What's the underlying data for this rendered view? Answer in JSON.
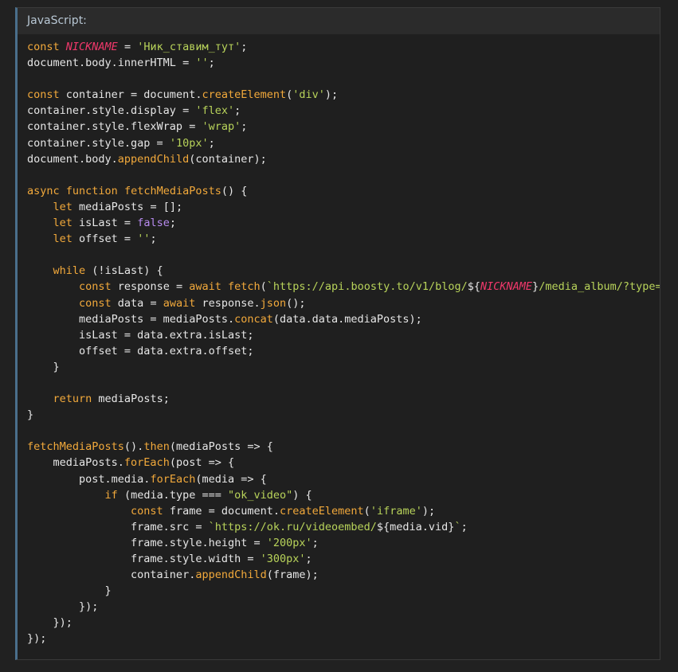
{
  "header": {
    "language_label": "JavaScript:"
  },
  "colors": {
    "background": "#212121",
    "code_background": "#1f1f1f",
    "header_background": "#2b2b2b",
    "accent_border": "#4a6f8c",
    "keyword": "#f2a93b",
    "string": "#b8d35a",
    "constant": "#f0386b",
    "boolean": "#b88bf0",
    "plain": "#e6e6e6"
  },
  "code_lines": [
    [
      [
        "keyword",
        "const"
      ],
      [
        "plain",
        " "
      ],
      [
        "const",
        "NICKNAME"
      ],
      [
        "plain",
        " = "
      ],
      [
        "string",
        "'Ник_ставим_тут'"
      ],
      [
        "plain",
        ";"
      ]
    ],
    [
      [
        "plain",
        "document.body.innerHTML = "
      ],
      [
        "string",
        "''"
      ],
      [
        "plain",
        ";"
      ]
    ],
    [],
    [
      [
        "keyword",
        "const"
      ],
      [
        "plain",
        " container = document."
      ],
      [
        "func",
        "createElement"
      ],
      [
        "plain",
        "("
      ],
      [
        "string",
        "'div'"
      ],
      [
        "plain",
        ");"
      ]
    ],
    [
      [
        "plain",
        "container.style.display = "
      ],
      [
        "string",
        "'flex'"
      ],
      [
        "plain",
        ";"
      ]
    ],
    [
      [
        "plain",
        "container.style.flexWrap = "
      ],
      [
        "string",
        "'wrap'"
      ],
      [
        "plain",
        ";"
      ]
    ],
    [
      [
        "plain",
        "container.style.gap = "
      ],
      [
        "string",
        "'10px'"
      ],
      [
        "plain",
        ";"
      ]
    ],
    [
      [
        "plain",
        "document.body."
      ],
      [
        "func",
        "appendChild"
      ],
      [
        "plain",
        "(container);"
      ]
    ],
    [],
    [
      [
        "keyword",
        "async"
      ],
      [
        "plain",
        " "
      ],
      [
        "keyword",
        "function"
      ],
      [
        "plain",
        " "
      ],
      [
        "func",
        "fetchMediaPosts"
      ],
      [
        "plain",
        "() {"
      ]
    ],
    [
      [
        "plain",
        "    "
      ],
      [
        "keyword",
        "let"
      ],
      [
        "plain",
        " mediaPosts = [];"
      ]
    ],
    [
      [
        "plain",
        "    "
      ],
      [
        "keyword",
        "let"
      ],
      [
        "plain",
        " isLast = "
      ],
      [
        "bool",
        "false"
      ],
      [
        "plain",
        ";"
      ]
    ],
    [
      [
        "plain",
        "    "
      ],
      [
        "keyword",
        "let"
      ],
      [
        "plain",
        " offset = "
      ],
      [
        "string",
        "''"
      ],
      [
        "plain",
        ";"
      ]
    ],
    [],
    [
      [
        "plain",
        "    "
      ],
      [
        "keyword",
        "while"
      ],
      [
        "plain",
        " (!isLast) {"
      ]
    ],
    [
      [
        "plain",
        "        "
      ],
      [
        "keyword",
        "const"
      ],
      [
        "plain",
        " response = "
      ],
      [
        "keyword",
        "await"
      ],
      [
        "plain",
        " "
      ],
      [
        "func",
        "fetch"
      ],
      [
        "plain",
        "("
      ],
      [
        "string",
        "`https://api.boosty.to/v1/blog/"
      ],
      [
        "plain",
        "${"
      ],
      [
        "const",
        "NICKNAME"
      ],
      [
        "plain",
        "}"
      ],
      [
        "string",
        "/media_album/?type=video&limit=100&offset="
      ],
      [
        "plain",
        "${offset}"
      ],
      [
        "string",
        "`"
      ],
      [
        "plain",
        ");"
      ]
    ],
    [
      [
        "plain",
        "        "
      ],
      [
        "keyword",
        "const"
      ],
      [
        "plain",
        " data = "
      ],
      [
        "keyword",
        "await"
      ],
      [
        "plain",
        " response."
      ],
      [
        "func",
        "json"
      ],
      [
        "plain",
        "();"
      ]
    ],
    [
      [
        "plain",
        "        mediaPosts = mediaPosts."
      ],
      [
        "func",
        "concat"
      ],
      [
        "plain",
        "(data.data.mediaPosts);"
      ]
    ],
    [
      [
        "plain",
        "        isLast = data.extra.isLast;"
      ]
    ],
    [
      [
        "plain",
        "        offset = data.extra.offset;"
      ]
    ],
    [
      [
        "plain",
        "    }"
      ]
    ],
    [],
    [
      [
        "plain",
        "    "
      ],
      [
        "keyword",
        "return"
      ],
      [
        "plain",
        " mediaPosts;"
      ]
    ],
    [
      [
        "plain",
        "}"
      ]
    ],
    [],
    [
      [
        "func",
        "fetchMediaPosts"
      ],
      [
        "plain",
        "()."
      ],
      [
        "func",
        "then"
      ],
      [
        "plain",
        "(mediaPosts => {"
      ]
    ],
    [
      [
        "plain",
        "    mediaPosts."
      ],
      [
        "func",
        "forEach"
      ],
      [
        "plain",
        "(post => {"
      ]
    ],
    [
      [
        "plain",
        "        post.media."
      ],
      [
        "func",
        "forEach"
      ],
      [
        "plain",
        "(media => {"
      ]
    ],
    [
      [
        "plain",
        "            "
      ],
      [
        "keyword",
        "if"
      ],
      [
        "plain",
        " (media.type === "
      ],
      [
        "string",
        "\"ok_video\""
      ],
      [
        "plain",
        ") {"
      ]
    ],
    [
      [
        "plain",
        "                "
      ],
      [
        "keyword",
        "const"
      ],
      [
        "plain",
        " frame = document."
      ],
      [
        "func",
        "createElement"
      ],
      [
        "plain",
        "("
      ],
      [
        "string",
        "'iframe'"
      ],
      [
        "plain",
        ");"
      ]
    ],
    [
      [
        "plain",
        "                frame.src = "
      ],
      [
        "string",
        "`https://ok.ru/videoembed/"
      ],
      [
        "plain",
        "${media.vid}"
      ],
      [
        "string",
        "`"
      ],
      [
        "plain",
        ";"
      ]
    ],
    [
      [
        "plain",
        "                frame.style.height = "
      ],
      [
        "string",
        "'200px'"
      ],
      [
        "plain",
        ";"
      ]
    ],
    [
      [
        "plain",
        "                frame.style.width = "
      ],
      [
        "string",
        "'300px'"
      ],
      [
        "plain",
        ";"
      ]
    ],
    [
      [
        "plain",
        "                container."
      ],
      [
        "func",
        "appendChild"
      ],
      [
        "plain",
        "(frame);"
      ]
    ],
    [
      [
        "plain",
        "            }"
      ]
    ],
    [
      [
        "plain",
        "        });"
      ]
    ],
    [
      [
        "plain",
        "    });"
      ]
    ],
    [
      [
        "plain",
        "});"
      ]
    ]
  ]
}
